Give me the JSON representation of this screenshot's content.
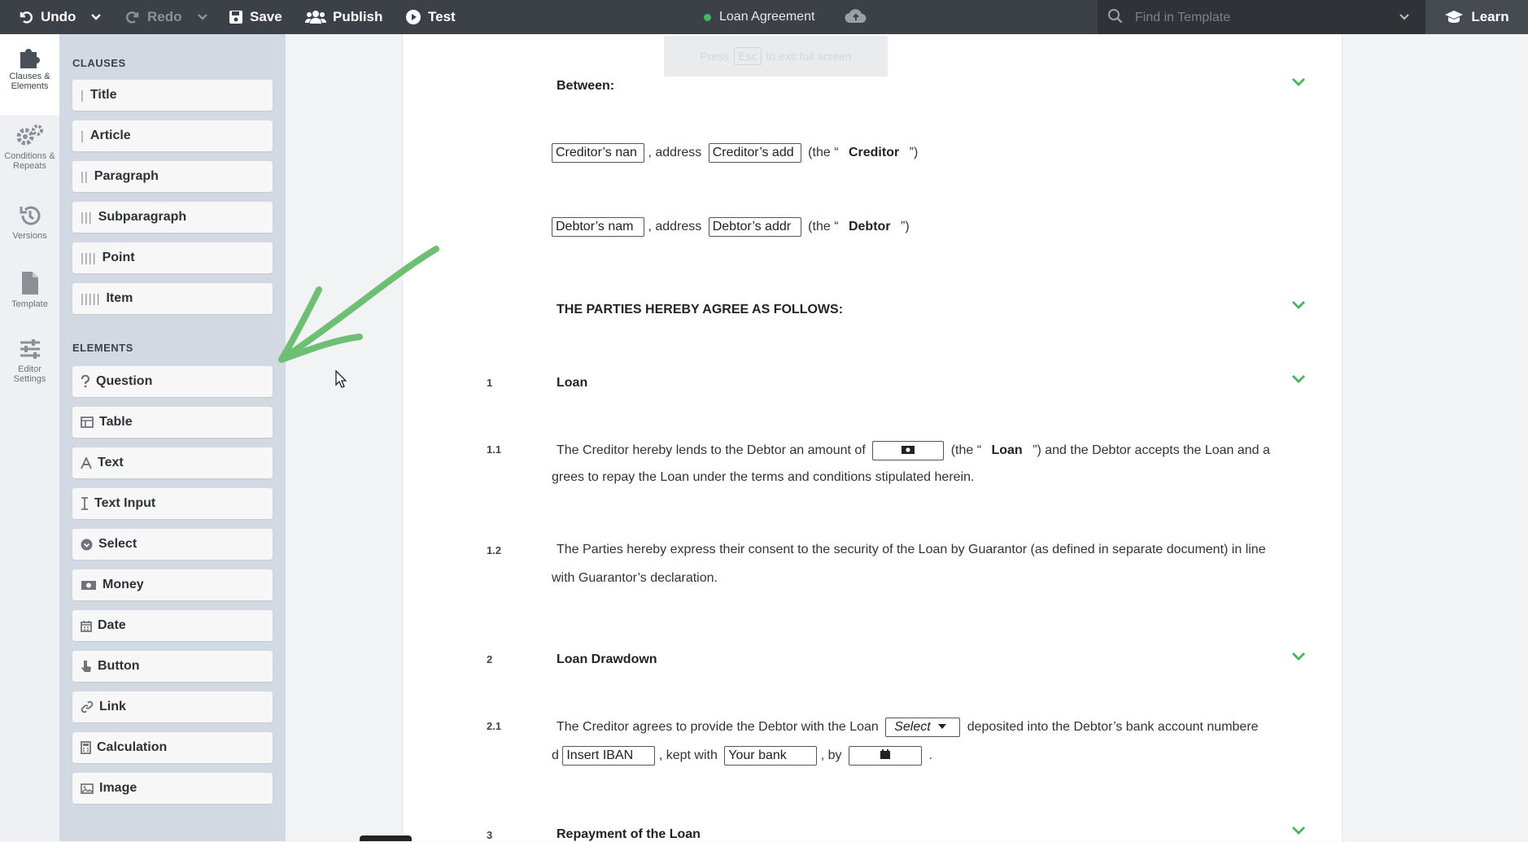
{
  "toolbar": {
    "undo_label": "Undo",
    "redo_label": "Redo",
    "save_label": "Save",
    "publish_label": "Publish",
    "test_label": "Test",
    "document_title": "Loan Agreement",
    "search_placeholder": "Find in Template",
    "learn_label": "Learn"
  },
  "esc_hint": {
    "before": "Press",
    "key": "Esc",
    "after": "to exit full screen"
  },
  "rail": [
    {
      "label_1": "Clauses &",
      "label_2": "Elements"
    },
    {
      "label_1": "Conditions &",
      "label_2": "Repeats"
    },
    {
      "label_1": "Versions",
      "label_2": ""
    },
    {
      "label_1": "Template",
      "label_2": ""
    },
    {
      "label_1": "Editor",
      "label_2": "Settings"
    }
  ],
  "palette": {
    "clauses_heading": "CLAUSES",
    "clauses": [
      {
        "label": "Title",
        "bars": "|"
      },
      {
        "label": "Article",
        "bars": "|"
      },
      {
        "label": "Paragraph",
        "bars": "||"
      },
      {
        "label": "Subparagraph",
        "bars": "|||"
      },
      {
        "label": "Point",
        "bars": "||||"
      },
      {
        "label": "Item",
        "bars": "|||||"
      }
    ],
    "elements_heading": "ELEMENTS",
    "elements": [
      {
        "label": "Question",
        "icon": "question-icon"
      },
      {
        "label": "Table",
        "icon": "table-icon"
      },
      {
        "label": "Text",
        "icon": "text-icon"
      },
      {
        "label": "Text Input",
        "icon": "text-cursor-icon"
      },
      {
        "label": "Select",
        "icon": "select-icon"
      },
      {
        "label": "Money",
        "icon": "money-icon"
      },
      {
        "label": "Date",
        "icon": "calendar-icon"
      },
      {
        "label": "Button",
        "icon": "pointer-icon"
      },
      {
        "label": "Link",
        "icon": "link-icon"
      },
      {
        "label": "Calculation",
        "icon": "calculator-icon"
      },
      {
        "label": "Image",
        "icon": "image-icon"
      }
    ]
  },
  "doc": {
    "between_label": "Between:",
    "creditor_name": "Creditor’s nan",
    "address_label": ", address",
    "creditor_address": "Creditor’s add",
    "the_open": "(the “",
    "creditor_term": "Creditor",
    "the_close": "”)",
    "debtor_name": "Debtor’s nam",
    "debtor_address": "Debtor’s addr",
    "debtor_term": "Debtor",
    "agree_heading": "THE PARTIES HEREBY AGREE AS FOLLOWS:",
    "s1_num": "1",
    "s1_title": "Loan",
    "s11_num": "1.1",
    "s11_a": "The Creditor hereby lends to the Debtor an amount of",
    "s11_the": "(the “",
    "s11_term": "Loan",
    "s11_b": "”) and the Debtor accepts the Loan and a",
    "s11_c": "grees to repay the Loan under the terms and conditions stipulated herein.",
    "s12_num": "1.2",
    "s12_a": "The Parties hereby express their consent to the security of the Loan by Guarantor (as defined in separate document) in line",
    "s12_b": "with Guarantor’s declaration.",
    "s2_num": "2",
    "s2_title": "Loan Drawdown",
    "s21_num": "2.1",
    "s21_a": "The Creditor agrees to provide the Debtor with the Loan",
    "s21_select": "Select",
    "s21_b": "deposited into the Debtor’s bank account numbere",
    "s21_c": "d",
    "s21_iban": "Insert IBAN",
    "s21_kept": ", kept with",
    "s21_bank": "Your bank",
    "s21_by": ", by",
    "s21_end": ".",
    "s3_num": "3",
    "s3_title": "Repayment of the Loan"
  },
  "colors": {
    "topbar": "#3c4148",
    "palette": "#d3d9e2",
    "accent_green": "#3dbb61",
    "arrow_green": "#6dbf73"
  }
}
